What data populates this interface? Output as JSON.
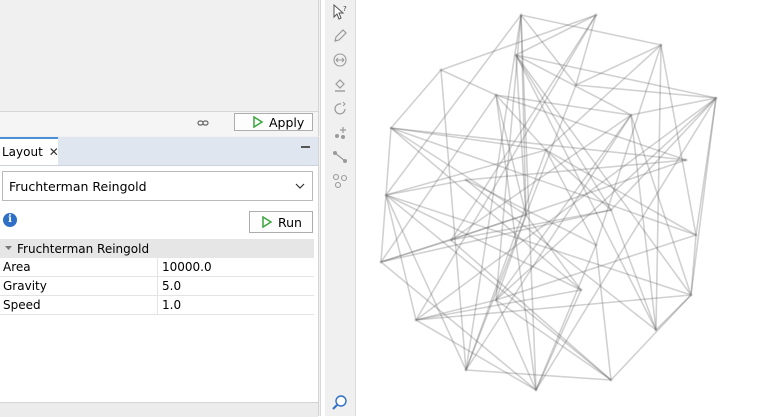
{
  "apply_label": "Apply",
  "layout_tab": {
    "label": "Layout",
    "close": "✕"
  },
  "algorithm_select": {
    "value": "Fruchterman Reingold"
  },
  "run_label": "Run",
  "properties": {
    "group": "Fruchterman Reingold",
    "rows": [
      {
        "name": "Area",
        "value": "10000.0"
      },
      {
        "name": "Gravity",
        "value": "5.0"
      },
      {
        "name": "Speed",
        "value": "1.0"
      }
    ]
  },
  "toolbar_icons": [
    "edit-cursor-icon",
    "pencil-icon",
    "resize-icon",
    "paint-bucket-icon",
    "rotate-icon",
    "add-node-icon",
    "add-edge-icon",
    "shortest-path-icon",
    "zoom-icon"
  ],
  "colors": {
    "accent": "#4a90d9",
    "play_green": "#3aa63a",
    "info_blue": "#2f6fc6",
    "edge_gray": "#5a5a5a"
  }
}
